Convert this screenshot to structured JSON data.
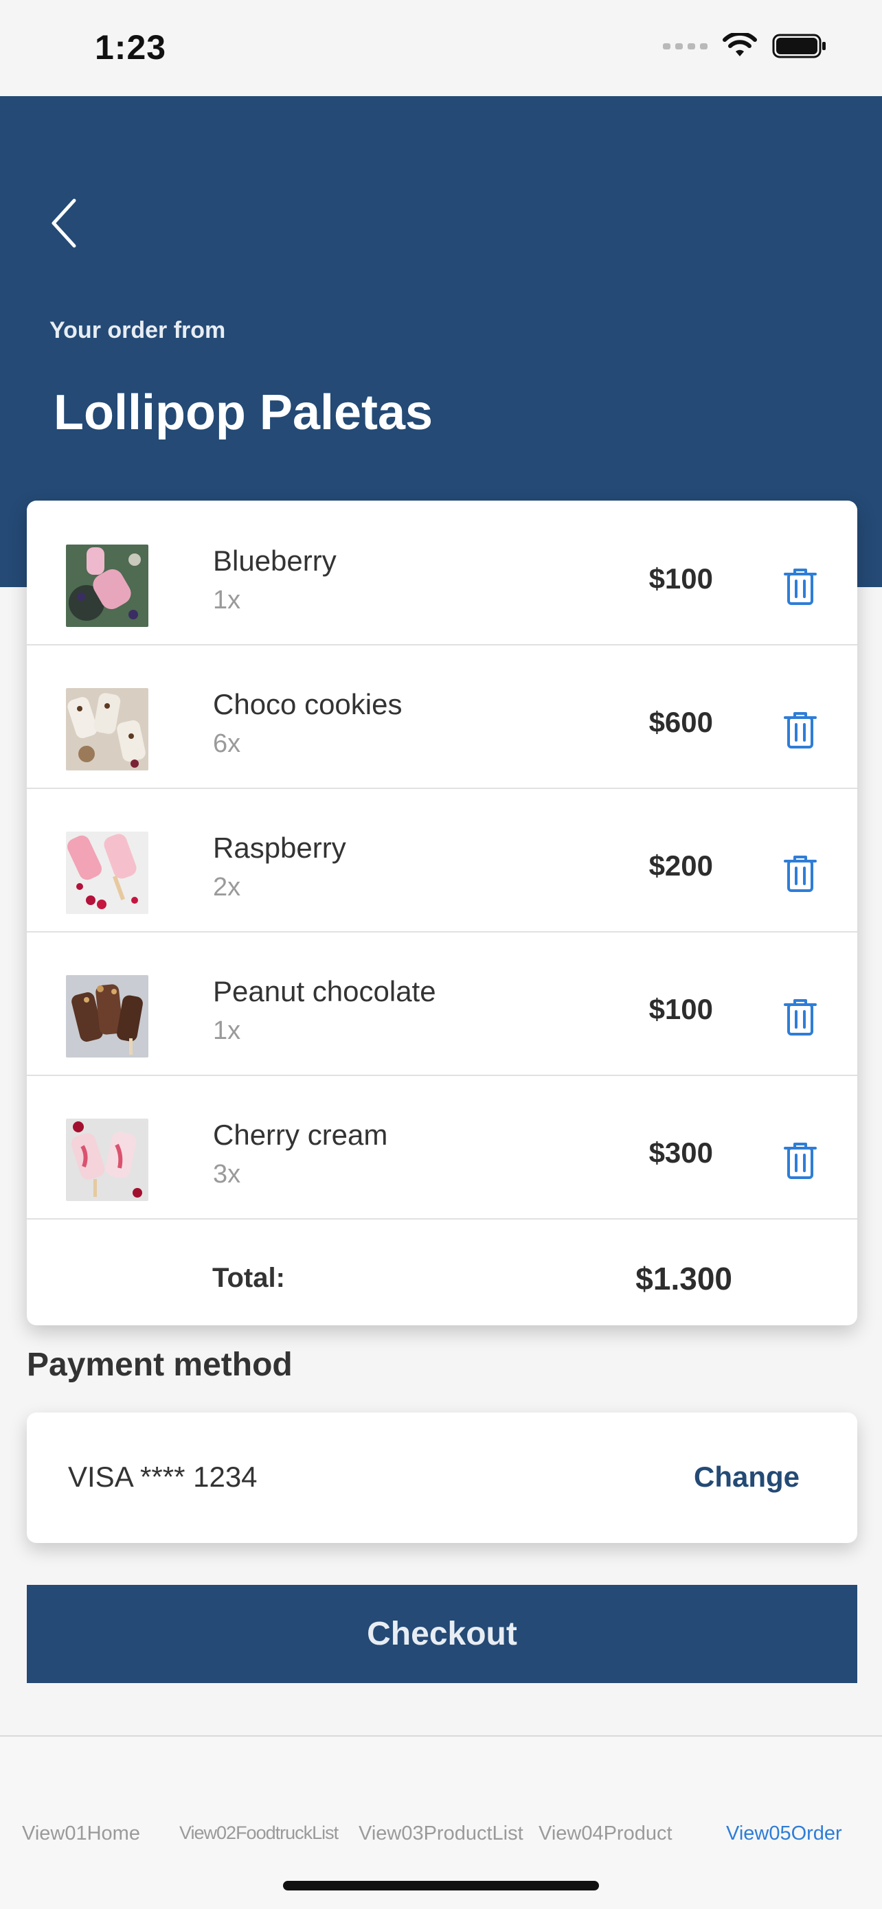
{
  "status_bar": {
    "time": "1:23"
  },
  "header": {
    "subtitle": "Your order from",
    "title": "Lollipop Paletas"
  },
  "order": {
    "items": [
      {
        "name": "Blueberry",
        "qty": "1x",
        "price": "$100"
      },
      {
        "name": "Choco cookies",
        "qty": "6x",
        "price": "$600"
      },
      {
        "name": "Raspberry",
        "qty": "2x",
        "price": "$200"
      },
      {
        "name": "Peanut chocolate",
        "qty": "1x",
        "price": "$100"
      },
      {
        "name": "Cherry cream",
        "qty": "3x",
        "price": "$300"
      }
    ],
    "total_label": "Total:",
    "total_value": "$1.300"
  },
  "payment": {
    "title": "Payment method",
    "card": "VISA **** 1234",
    "change_label": "Change"
  },
  "checkout_label": "Checkout",
  "tabs": [
    {
      "label": "View01Home"
    },
    {
      "label": "View02FoodtruckList"
    },
    {
      "label": "View03ProductList"
    },
    {
      "label": "View04Product"
    },
    {
      "label": "View05Order"
    }
  ],
  "colors": {
    "brand": "#244a75",
    "accent": "#2e7dd7",
    "background": "#f5f5f5"
  },
  "icons": [
    "chevron-left-icon",
    "trash-icon",
    "wifi-icon",
    "battery-icon",
    "signal-icon"
  ]
}
